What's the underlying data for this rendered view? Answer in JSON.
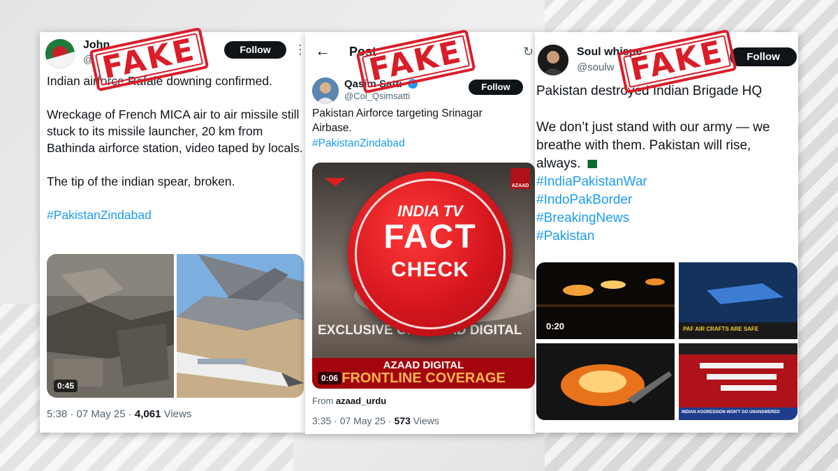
{
  "stamps": {
    "fake_label": "FAKE"
  },
  "fact_check_badge": {
    "line1": "INDIA TV",
    "line2": "FACT",
    "line3": "CHECK"
  },
  "post1": {
    "display_name": "John",
    "handle": "@",
    "follow_label": "Follow",
    "text_line1": "Indian airforce Rafale downing confirmed.",
    "text_para2": "Wreckage of French MICA air to air missile still stuck to its missile launcher, 20 km from Bathinda airforce station, video taped by locals.",
    "text_para3": "The tip of the indian spear, broken.",
    "hashtag": "#PakistanZindabad",
    "video_duration": "0:45",
    "time": "5:38 · 07 May 25 · ",
    "views_count": "4,061",
    "views_label": " Views"
  },
  "post2": {
    "header_title": "Post",
    "display_name": "Qasim Satti",
    "handle": "@Col_Qsimsatti",
    "follow_label": "Follow",
    "text": "Pakistan Airforce targeting Srinagar Airbase.",
    "hashtag": "#PakistanZindabad",
    "video_banner_top": "EXCLUSIVE ON AZAAD DIGITAL",
    "video_banner_mid": "AZAAD DIGITAL",
    "video_banner_bottom": "FRONTLINE COVERAGE",
    "logo_text": "AZAAD",
    "video_duration": "0:06",
    "from_label": "From ",
    "from_source": "azaad_urdu",
    "time": "3:35 · 07 May 25 · ",
    "views_count": "573",
    "views_label": " Views"
  },
  "post3": {
    "display_name": "Soul whispe",
    "handle": "@soulw",
    "follow_label": "Follow",
    "text_line1": "Pakistan destroyed Indian Brigade HQ",
    "text_para2": "We don’t just stand with our army — we breathe with them. Pakistan will rise, always.",
    "hashtags": [
      "#IndiaPakistanWar",
      "#IndoPakBorder",
      "#BreakingNews",
      "#Pakistan"
    ],
    "video_duration": "0:20",
    "news_ticker_1": "PAF AIR CRAFTS ARE SAFE",
    "news_ticker_2": "INDIAN AGGRESSION WON'T GO UNANSWERED"
  }
}
